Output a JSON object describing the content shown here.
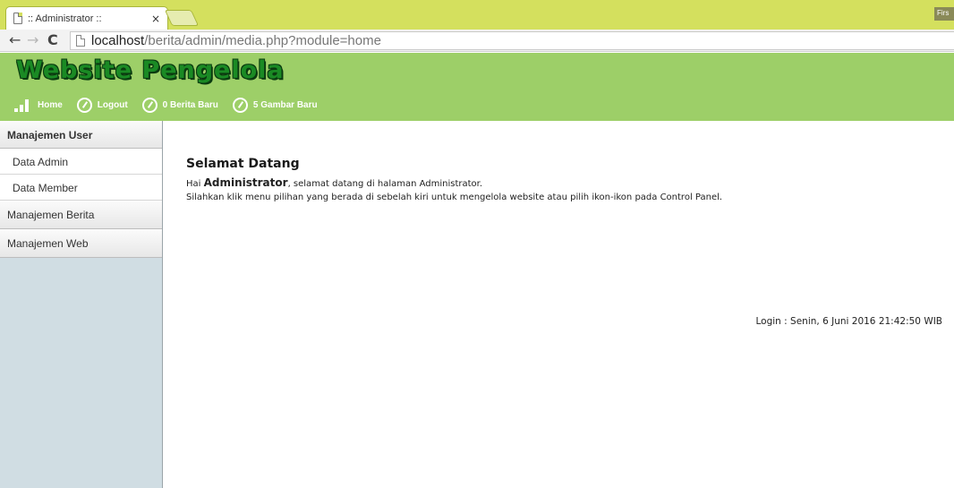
{
  "browser": {
    "tab_title": ":: Administrator ::",
    "tab_close": "×",
    "profile": "Firs",
    "url_host": "localhost",
    "url_path": "/berita/admin/media.php?module=home",
    "back_glyph": "←",
    "forward_glyph": "→",
    "reload_glyph": "C"
  },
  "header": {
    "title": "Website Pengelola",
    "nav": [
      {
        "label": "Home",
        "icon": "signal-bars-icon"
      },
      {
        "label": "Logout",
        "icon": "compass-icon"
      },
      {
        "label": "0 Berita Baru",
        "icon": "compass-icon"
      },
      {
        "label": "5 Gambar Baru",
        "icon": "compass-icon"
      }
    ]
  },
  "sidebar": {
    "sections": [
      {
        "label": "Manajemen User",
        "items": [
          "Data Admin",
          "Data Member"
        ]
      },
      {
        "label": "Manajemen Berita"
      },
      {
        "label": "Manajemen Web"
      }
    ]
  },
  "main": {
    "title": "Selamat Datang",
    "greeting_prefix": "Hai ",
    "greeting_name": "Administrator",
    "greeting_suffix": ", selamat datang di halaman Administrator.",
    "instruction": "Silahkan klik menu pilihan yang berada di sebelah kiri untuk mengelola website atau pilih ikon-ikon pada Control Panel.",
    "login_info": "Login : Senin, 6 Juni 2016 21:42:50 WIB"
  },
  "colors": {
    "tab_strip": "#d4e05e",
    "header_bg": "#9dcf68",
    "title_green": "#1a8a24",
    "sidebar_bg": "#d0dde3"
  }
}
